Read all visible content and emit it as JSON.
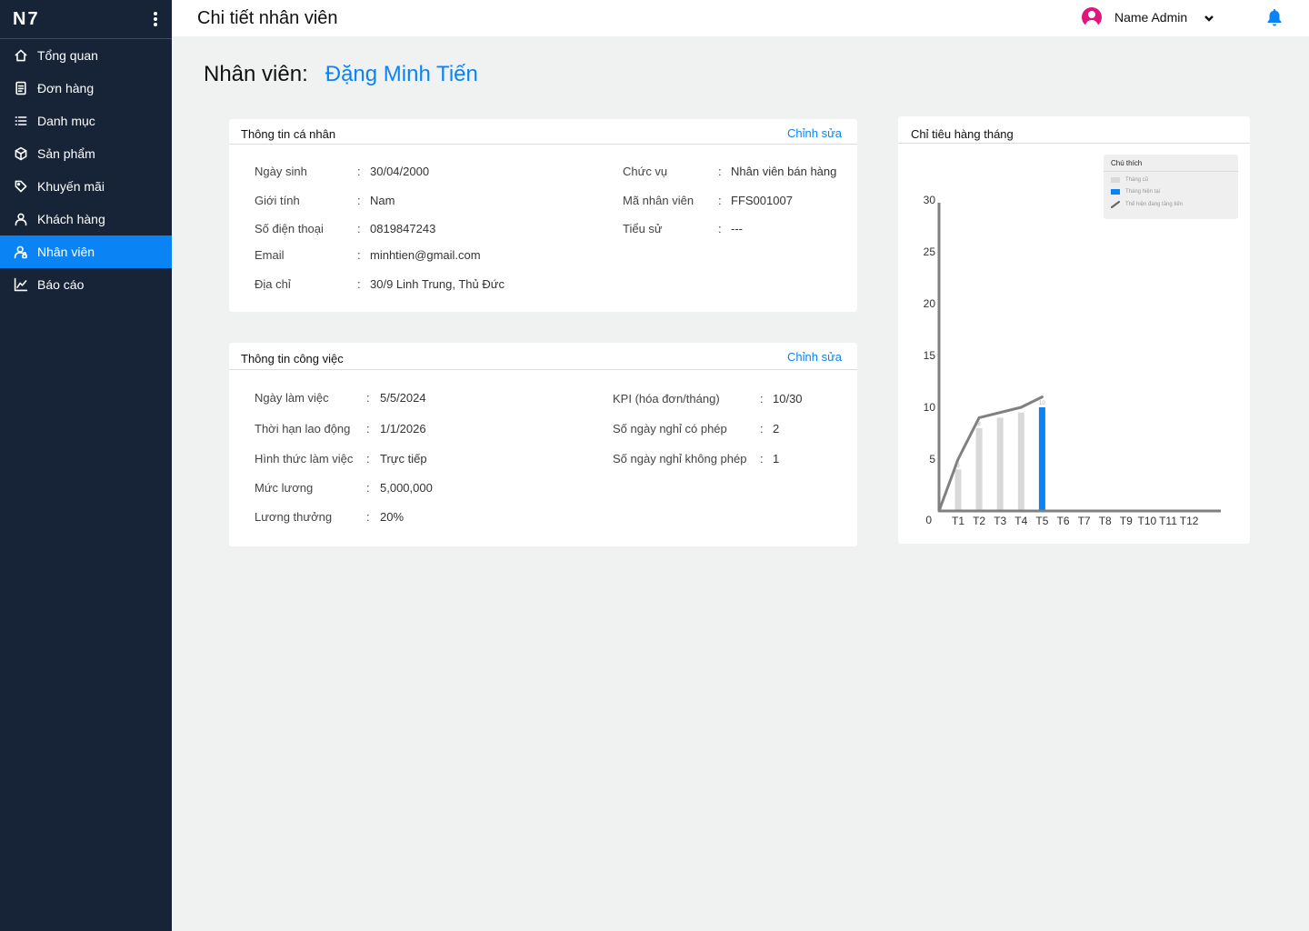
{
  "sidebar": {
    "brand": "N7",
    "items": [
      {
        "label": "Tổng quan",
        "icon": "home-icon",
        "active": false
      },
      {
        "label": "Đơn hàng",
        "icon": "document-icon",
        "active": false
      },
      {
        "label": "Danh mục",
        "icon": "list-icon",
        "active": false
      },
      {
        "label": "Sản phẩm",
        "icon": "box-icon",
        "active": false
      },
      {
        "label": "Khuyến mãi",
        "icon": "tag-icon",
        "active": false
      },
      {
        "label": "Khách hàng",
        "icon": "user-icon",
        "active": false
      },
      {
        "label": "Nhân viên",
        "icon": "user-lock-icon",
        "active": true
      },
      {
        "label": "Báo cáo",
        "icon": "chart-line-icon",
        "active": false
      }
    ]
  },
  "header": {
    "title": "Chi tiết nhân viên",
    "user_name": "Name Admin"
  },
  "employee": {
    "label": "Nhân viên:",
    "name": "Đặng Minh Tiến"
  },
  "personal": {
    "title": "Thông tin cá nhân",
    "edit": "Chỉnh sửa",
    "left": [
      {
        "label": "Ngày sinh",
        "value": "30/04/2000"
      },
      {
        "label": "Giới tính",
        "value": "Nam"
      },
      {
        "label": "Số điện thoại",
        "value": "0819847243"
      },
      {
        "label": "Email",
        "value": "minhtien@gmail.com"
      },
      {
        "label": "Địa chỉ",
        "value": "30/9 Linh Trung, Thủ Đức"
      }
    ],
    "right": [
      {
        "label": "Chức vụ",
        "value": "Nhân viên bán hàng"
      },
      {
        "label": "Mã nhân viên",
        "value": "FFS001007"
      },
      {
        "label": "Tiểu sử",
        "value": "---"
      }
    ]
  },
  "work": {
    "title": "Thông tin công việc",
    "edit": "Chỉnh sửa",
    "left": [
      {
        "label": "Ngày làm việc",
        "value": "5/5/2024"
      },
      {
        "label": "Thời hạn lao động",
        "value": "1/1/2026"
      },
      {
        "label": "Hình thức làm việc",
        "value": "Trực tiếp"
      },
      {
        "label": "Mức lương",
        "value": "5,000,000"
      },
      {
        "label": "Lương thưởng",
        "value": "20%"
      }
    ],
    "right": [
      {
        "label": "KPI (hóa đơn/tháng)",
        "value": "10/30"
      },
      {
        "label": "Số ngày nghỉ có phép",
        "value": "2"
      },
      {
        "label": "Số ngày nghỉ không phép",
        "value": "1"
      }
    ]
  },
  "chart_data": {
    "type": "bar",
    "title": "Chỉ tiêu hàng tháng",
    "categories": [
      "T1",
      "T2",
      "T3",
      "T4",
      "T5",
      "T6",
      "T7",
      "T8",
      "T9",
      "T10",
      "T11",
      "T12"
    ],
    "values": [
      4,
      8,
      9,
      9.5,
      10,
      null,
      null,
      null,
      null,
      null,
      null,
      null
    ],
    "current_index": 4,
    "trend_line": [
      0,
      5,
      9,
      10,
      11
    ],
    "point_labels": {
      "0": "5",
      "1": "8",
      "4": "10"
    },
    "y_ticks": [
      0,
      5,
      10,
      15,
      20,
      25,
      30
    ],
    "ylim": [
      0,
      30
    ],
    "colors": {
      "past": "#d9d9d9",
      "current": "#0a84f5",
      "trend": "#808080"
    },
    "legend": {
      "title": "Chú thích",
      "items": [
        "Tháng cũ",
        "Tháng hiện tại",
        "Thể hiện đang tăng tiến"
      ]
    }
  }
}
